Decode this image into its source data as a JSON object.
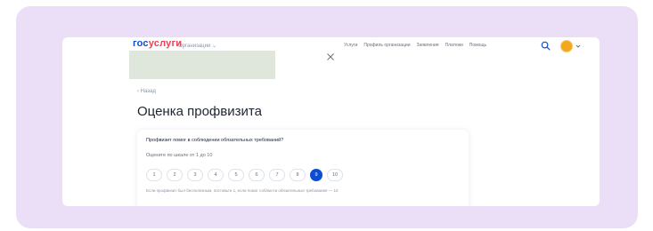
{
  "header": {
    "logo_part1": "гос",
    "logo_part2": "услуги",
    "org_switch_label": "Организации",
    "nav": [
      "Услуги",
      "Профиль организации",
      "Заявления",
      "Платежи",
      "Помощь"
    ]
  },
  "back_label": "‹ Назад",
  "page_title": "Оценка профвизита",
  "survey": {
    "question": "Профвизит помог в соблюдении обязательных требований?",
    "scale_hint": "Оцените по шкале от 1 до 10",
    "options": [
      "1",
      "2",
      "3",
      "4",
      "5",
      "6",
      "7",
      "8",
      "9",
      "10"
    ],
    "selected": "9",
    "footnote": "Если профвизит был бесполезным, поставьте 1, если помог соблюсти обязательные требования — 10"
  },
  "colors": {
    "frame": "#eadff7",
    "brand_blue": "#0d4cd3",
    "brand_red": "#ee3f58",
    "avatar": "#f3a71c"
  },
  "icons": [
    "search-icon",
    "chevron-down-icon",
    "close-icon",
    "avatar"
  ]
}
